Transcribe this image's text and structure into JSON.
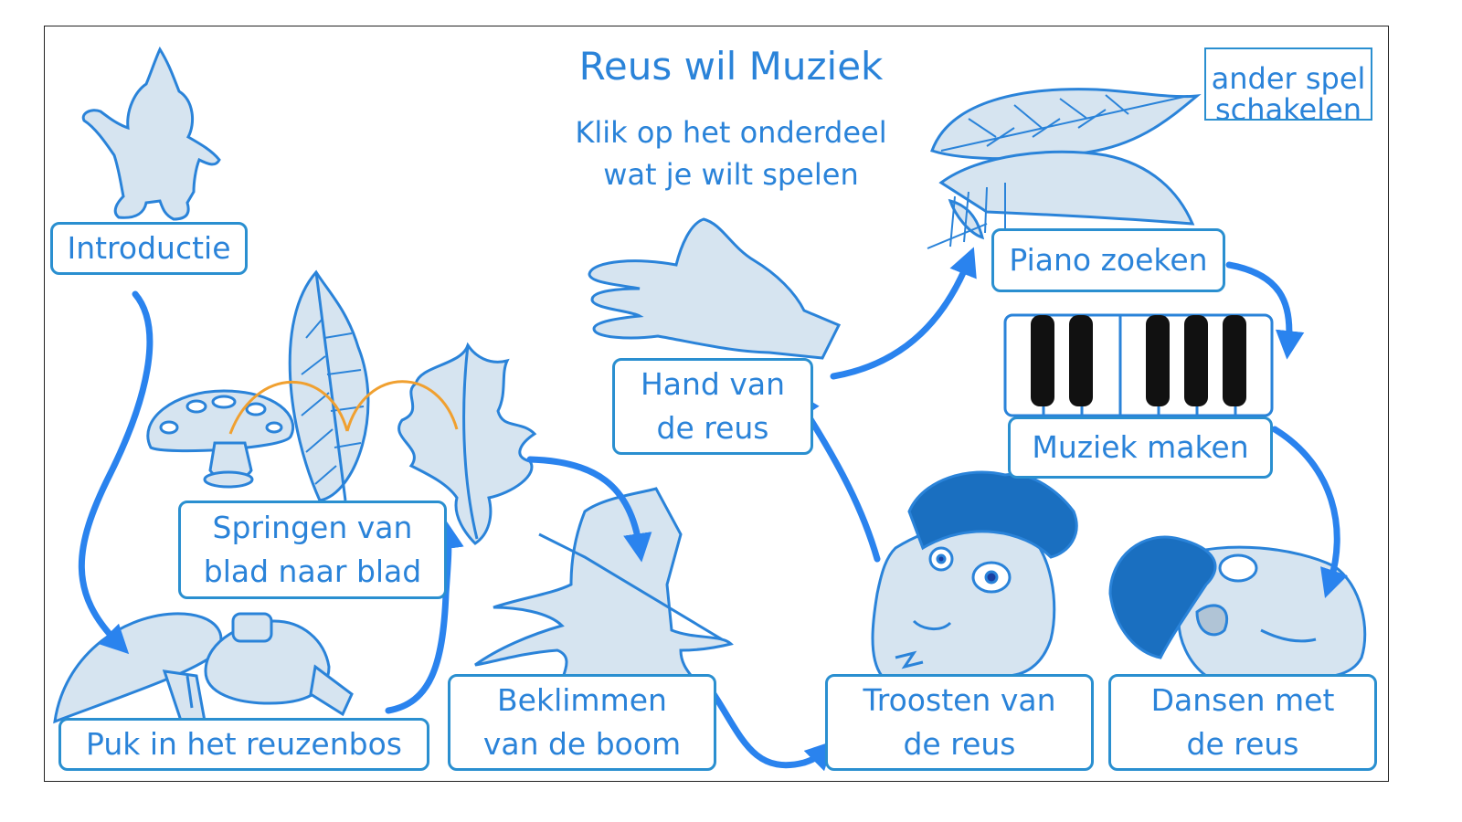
{
  "header": {
    "title": "Reus wil Muziek",
    "subtitle": "Klik op het onderdeel\nwat je wilt spelen"
  },
  "other_game": {
    "line1": "ander spel",
    "line2": "schakelen"
  },
  "chapters": [
    {
      "id": "introductie",
      "label": "Introductie"
    },
    {
      "id": "puk",
      "label": "Puk in het reuzenbos"
    },
    {
      "id": "springen",
      "label": "Springen van\nblad naar blad"
    },
    {
      "id": "beklimmen",
      "label": "Beklimmen\nvan de boom"
    },
    {
      "id": "troosten",
      "label": "Troosten van\nde reus"
    },
    {
      "id": "hand",
      "label": "Hand van\nde reus"
    },
    {
      "id": "piano",
      "label": "Piano zoeken"
    },
    {
      "id": "muziek",
      "label": "Muziek maken"
    },
    {
      "id": "dansen",
      "label": "Dansen met\nde reus"
    }
  ],
  "colors": {
    "accent": "#2a83d9",
    "fill": "#d6e4f0",
    "arrow": "#2a83ee",
    "jump_arc": "#f0a030"
  }
}
